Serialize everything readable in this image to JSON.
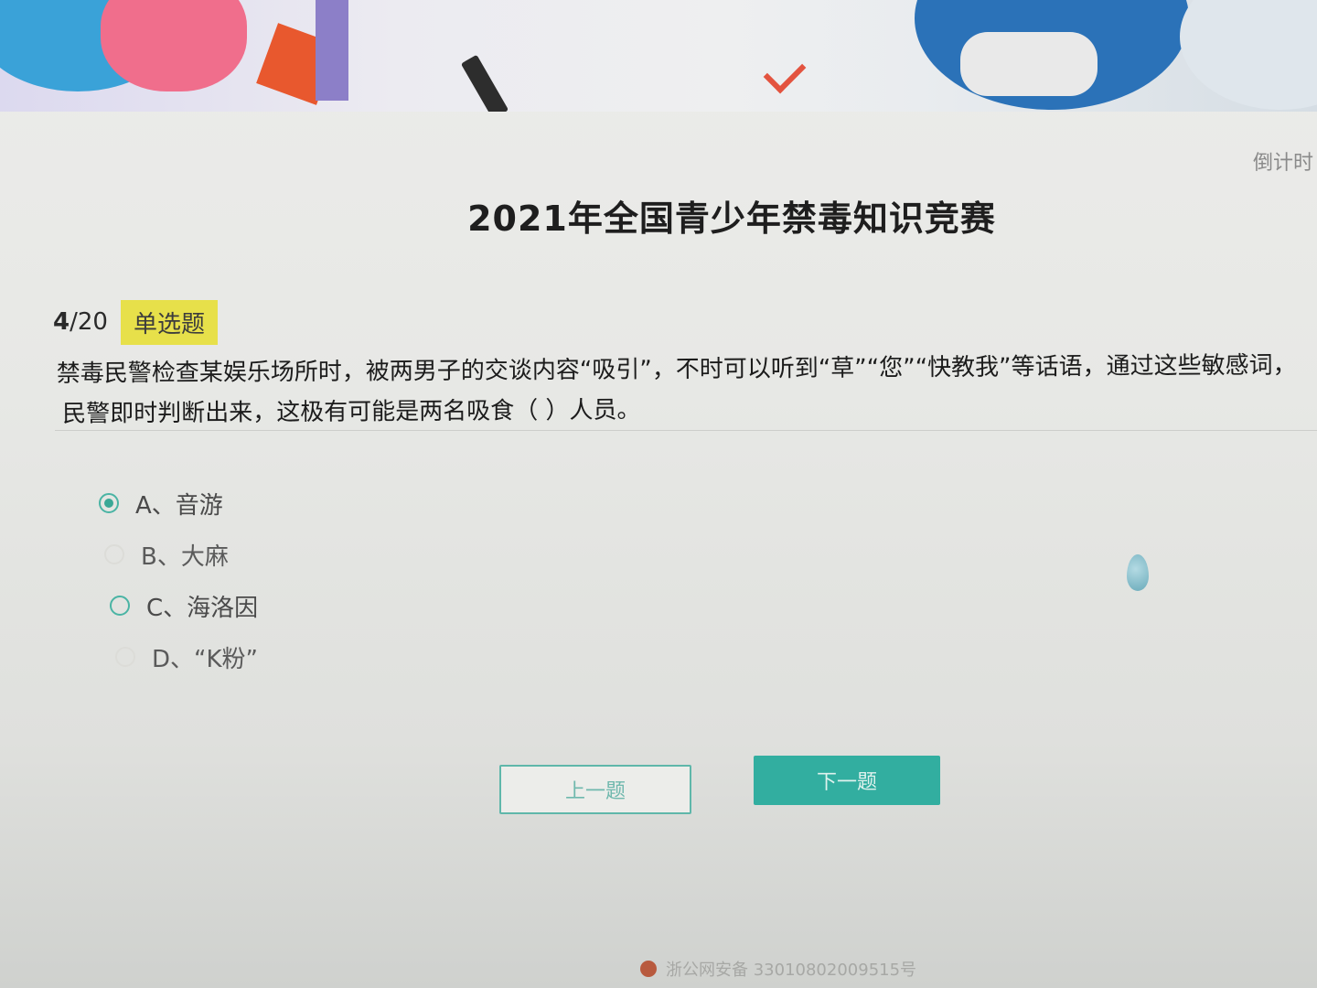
{
  "header": {
    "title": "2021年全国青少年禁毒知识竞赛",
    "countdown_label": "倒计时"
  },
  "question": {
    "current": "4",
    "total": "/20",
    "type": "单选题",
    "line1": "禁毒民警检查某娱乐场所时，被两男子的交谈内容“吸引”，不时可以听到“草”“您”“快教我”等话语，通过这些敏感词，",
    "line2": "民警即时判断出来，这极有可能是两名吸食（  ）人员。"
  },
  "options": [
    {
      "label": "A、音游",
      "selected": true
    },
    {
      "label": "B、大麻",
      "selected": false
    },
    {
      "label": "C、海洛因",
      "selected": false
    },
    {
      "label": "D、“K粉”",
      "selected": false
    }
  ],
  "buttons": {
    "prev": "上一题",
    "next": "下一题"
  },
  "footer": {
    "text": "浙公网安备 33010802009515号"
  },
  "colors": {
    "accent": "#32aea0",
    "type_badge": "#e7e04a"
  }
}
